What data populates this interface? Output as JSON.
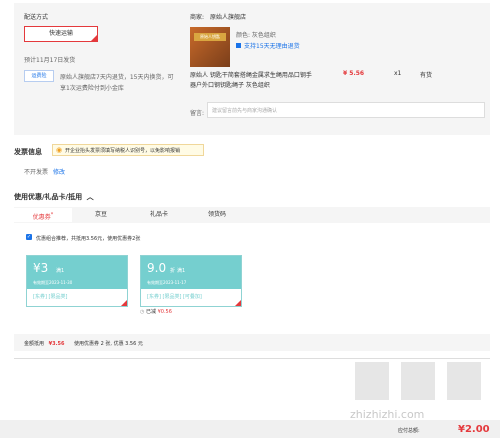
{
  "delivery": {
    "section_label": "配送方式",
    "method_button": "快速运输",
    "estimate": "预计11月17日发货",
    "service_badge": "运费险",
    "service_text_line1": "原始人旗舰店7天内退货，15天内换货，可",
    "service_text_line2": "享1次运费险付到小金库"
  },
  "store": {
    "label": "商家:",
    "name": "原始人旗舰店",
    "product_image_text": "原始人钥匙",
    "color": "颜色: 灰色组织",
    "return_policy": "支持15天无理由退货",
    "title_line1": "原始人 钥匙干简套搭绳金属求生绳用品口钢手",
    "title_line2": "器户外口钢钥匙绳子 灰色组织",
    "price": "¥ 5.56",
    "qty": "x1",
    "stock": "有货",
    "remark_label": "留言:",
    "remark_placeholder": "建议留言前先与商家沟通确认"
  },
  "invoice": {
    "title": "发票信息",
    "tip": "开企业抬头发票须填写纳税人识别号，以免影响报销",
    "status": "不开发票",
    "edit": "修改"
  },
  "discount": {
    "title": "使用优惠/礼品卡/抵用",
    "tabs": [
      "优惠券",
      "京豆",
      "礼品卡",
      "领货码"
    ],
    "combo_text": "优惠组合推荐，共抵用3.56元，使用优惠券2张"
  },
  "coupons": [
    {
      "amount": "¥3",
      "tag": "满1",
      "valid": "有效期至2023-11-30",
      "chips": "[东券] [限品类]"
    },
    {
      "amount": "9.0",
      "unit": "折",
      "tag": "满1",
      "valid": "有效期至2023-11-17",
      "chips": "[东券] [限品类] [可叠加]",
      "saved_label": "已减",
      "saved_amount": "¥0.56"
    }
  ],
  "summary": {
    "label": "金额抵用",
    "amount": "¥3.56",
    "text": "使用优惠券 2 张, 优惠 3.56 元"
  },
  "footer": {
    "payable_label": "应付总额:",
    "payable_amount": "¥2.00",
    "watermark": "zhizhizhi.com"
  },
  "colors": {
    "accent": "#e4393c",
    "coupon": "#75cfcf",
    "link": "#1a73e8"
  }
}
